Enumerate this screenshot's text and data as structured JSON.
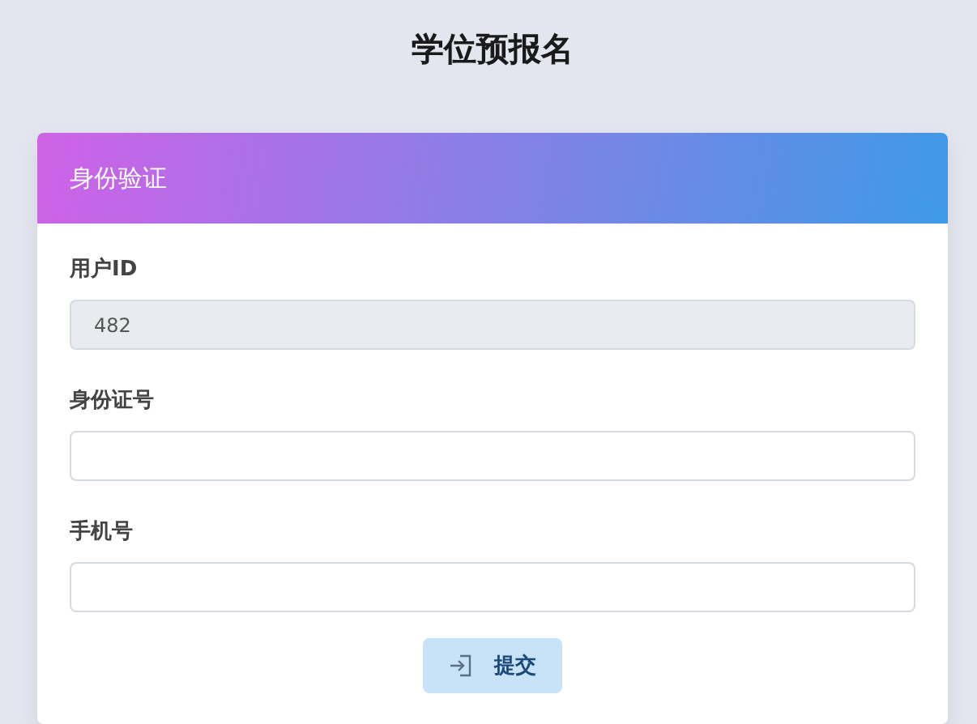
{
  "page": {
    "title": "学位预报名"
  },
  "card": {
    "title": "身份验证"
  },
  "fields": [
    {
      "label": "用户ID",
      "value": "482",
      "disabled": true
    },
    {
      "label": "身份证号",
      "disabled": false
    },
    {
      "label": "手机号",
      "disabled": false
    }
  ],
  "submit_button": {
    "label": "提交"
  }
}
